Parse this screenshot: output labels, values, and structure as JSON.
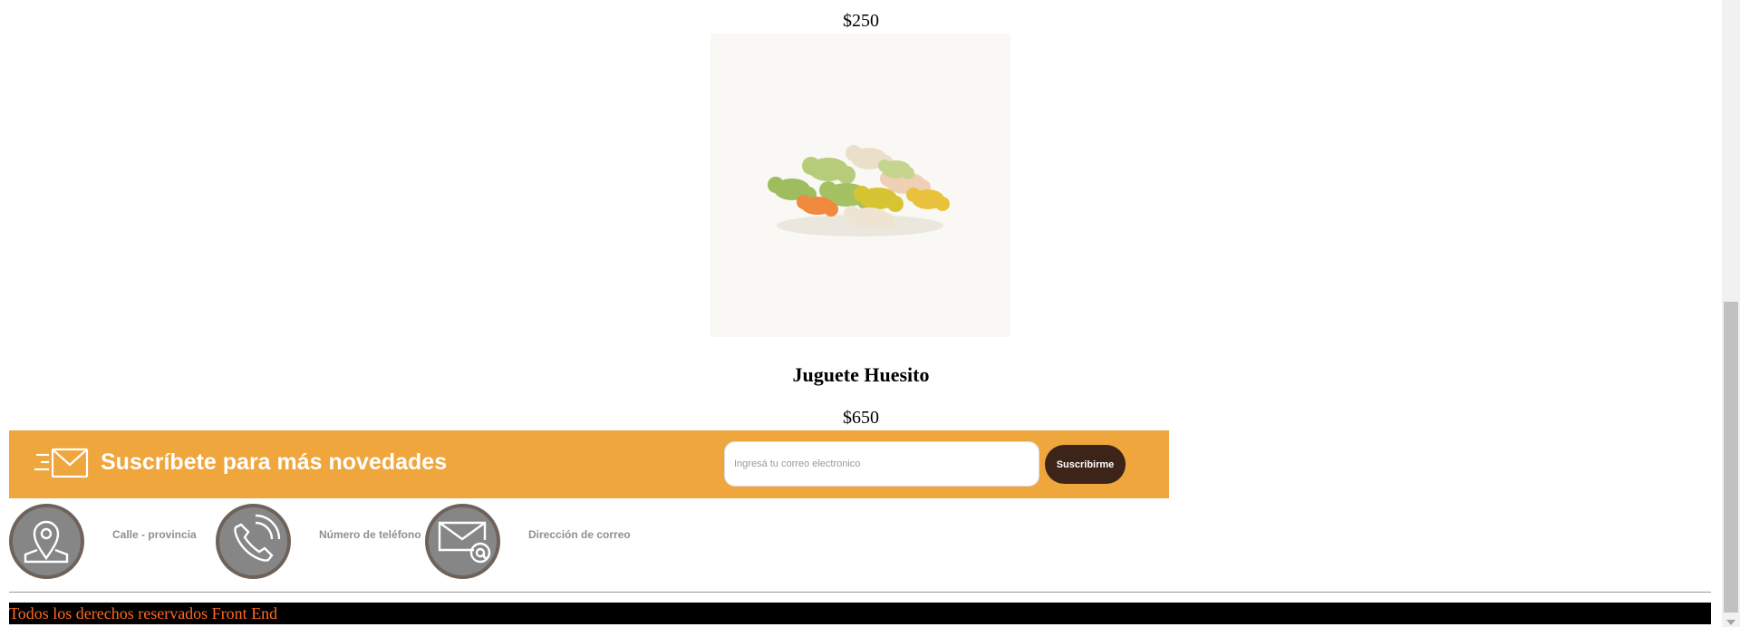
{
  "product_prev": {
    "price": "$250"
  },
  "product": {
    "image_alt": "colorful bone-shaped dog treats",
    "title": "Juguete Huesito",
    "price": "$650"
  },
  "newsletter": {
    "icon": "envelope-fast-icon",
    "heading": "Suscríbete para más novedades",
    "email_placeholder": "Ingresá tu correo electronico",
    "email_value": "",
    "subscribe_label": "Suscribirme",
    "bg_color": "#efa63d",
    "button_color": "#3c2418"
  },
  "contact": {
    "address": {
      "icon": "location-pin-icon",
      "label": "Calle - provincia"
    },
    "phone": {
      "icon": "phone-icon",
      "label": "Número de teléfono"
    },
    "email": {
      "icon": "mail-at-icon",
      "label": "Dirección de correo"
    }
  },
  "footer": {
    "text": "Todos los derechos reservados Front End",
    "text_color": "#ff6a21"
  }
}
